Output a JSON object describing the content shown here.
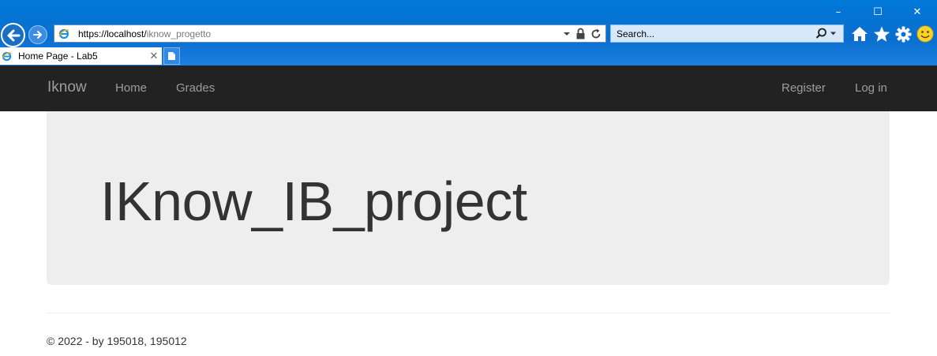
{
  "browser": {
    "window_controls": {
      "minimize": "–",
      "maximize": "☐",
      "close": "✕"
    },
    "address": {
      "protocol_host": "https://localhost/",
      "path": "iknow_progetto"
    },
    "search": {
      "placeholder": "Search..."
    },
    "tab": {
      "title": "Home Page - Lab5",
      "close": "✕"
    },
    "icons": [
      "back-icon",
      "forward-icon",
      "ie-favicon",
      "dropdown-icon",
      "lock-icon",
      "refresh-icon",
      "search-icon",
      "home-icon",
      "favorites-star-icon",
      "settings-gear-icon",
      "smiley-feedback-icon",
      "new-tab-icon"
    ],
    "colors": {
      "chrome": "#0078d7",
      "search_bg": "#d6e8fa"
    }
  },
  "navbar": {
    "brand": "Iknow",
    "links": [
      "Home",
      "Grades"
    ],
    "right_links": [
      "Register",
      "Log in"
    ],
    "colors": {
      "bg": "#222222",
      "link": "#9d9d9d"
    }
  },
  "jumbotron": {
    "title": "IKnow_IB_project",
    "colors": {
      "bg": "#eeeeee",
      "text": "#333333"
    }
  },
  "footer": {
    "text": "© 2022 - by 195018, 195012"
  }
}
